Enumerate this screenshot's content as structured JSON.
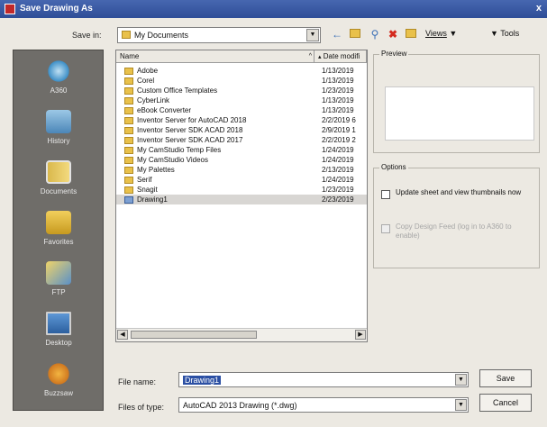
{
  "window": {
    "title": "Save Drawing As",
    "close": "x"
  },
  "save_in": {
    "label": "Save in:",
    "value": "My Documents"
  },
  "toolbar": {
    "views": "Views",
    "tools": "Tools",
    "dropdown_arrow": "▼"
  },
  "places": [
    {
      "label": "A360",
      "icon": "cloud-icon"
    },
    {
      "label": "History",
      "icon": "history-icon"
    },
    {
      "label": "Documents",
      "icon": "documents-folder-icon"
    },
    {
      "label": "Favorites",
      "icon": "favorites-icon"
    },
    {
      "label": "FTP",
      "icon": "ftp-icon"
    },
    {
      "label": "Desktop",
      "icon": "desktop-icon"
    },
    {
      "label": "Buzzsaw",
      "icon": "buzzsaw-icon"
    }
  ],
  "filelist": {
    "col_name": "Name",
    "col_date": "Date modifi",
    "rows": [
      {
        "name": "Adobe",
        "date": "1/13/2019",
        "type": "folder"
      },
      {
        "name": "Corel",
        "date": "1/13/2019",
        "type": "folder"
      },
      {
        "name": "Custom Office Templates",
        "date": "1/23/2019",
        "type": "folder"
      },
      {
        "name": "CyberLink",
        "date": "1/13/2019",
        "type": "folder"
      },
      {
        "name": "eBook Converter",
        "date": "1/13/2019",
        "type": "folder"
      },
      {
        "name": "Inventor Server for AutoCAD 2018",
        "date": "2/2/2019 6",
        "type": "folder"
      },
      {
        "name": "Inventor Server SDK ACAD 2018",
        "date": "2/9/2019 1",
        "type": "folder"
      },
      {
        "name": "Inventor Server SDK ACAD 2017",
        "date": "2/2/2019 2",
        "type": "folder"
      },
      {
        "name": "My CamStudio Temp Files",
        "date": "1/24/2019",
        "type": "folder"
      },
      {
        "name": "My CamStudio Videos",
        "date": "1/24/2019",
        "type": "folder"
      },
      {
        "name": "My Palettes",
        "date": "2/13/2019",
        "type": "folder"
      },
      {
        "name": "Serif",
        "date": "1/24/2019",
        "type": "folder"
      },
      {
        "name": "Snagit",
        "date": "1/23/2019",
        "type": "folder"
      },
      {
        "name": "Drawing1",
        "date": "2/23/2019",
        "type": "dwg",
        "selected": true
      }
    ]
  },
  "preview": {
    "label": "Preview"
  },
  "options": {
    "label": "Options",
    "update_thumbnails": "Update sheet and view thumbnails now",
    "copy_design_feed": "Copy Design Feed (log in to A360 to enable)"
  },
  "file_name": {
    "label": "File name:",
    "value": "Drawing1"
  },
  "file_type": {
    "label": "Files of type:",
    "value": "AutoCAD 2013 Drawing (*.dwg)"
  },
  "buttons": {
    "save": "Save",
    "cancel": "Cancel"
  },
  "colors": {
    "titlebar": "#2e4d97",
    "places_bg": "#6f6d69",
    "selection": "#2b4fa3"
  }
}
